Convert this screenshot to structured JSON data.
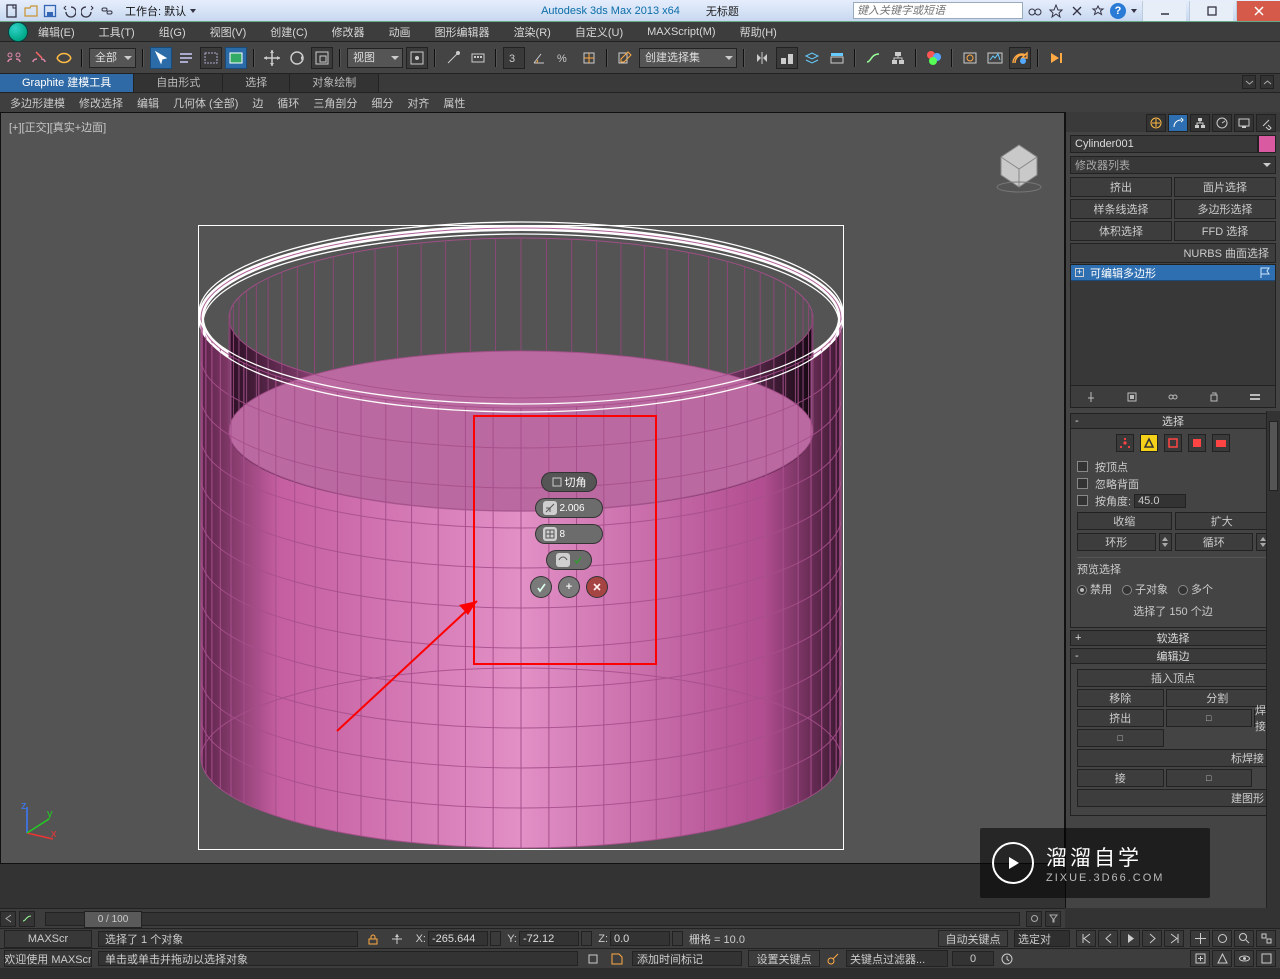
{
  "win": {
    "workspace_label": "工作台: 默认",
    "title_app": "Autodesk 3ds Max  2013 x64",
    "title_doc": "无标题",
    "search_ph": "键入关键字或短语"
  },
  "menu": [
    "编辑(E)",
    "工具(T)",
    "组(G)",
    "视图(V)",
    "创建(C)",
    "修改器",
    "动画",
    "图形编辑器",
    "渲染(R)",
    "自定义(U)",
    "MAXScript(M)",
    "帮助(H)"
  ],
  "toolbar": {
    "filter": "全部",
    "view": "视图",
    "named_sel": "创建选择集"
  },
  "ribbon": {
    "tabs": [
      "Graphite 建模工具",
      "自由形式",
      "选择",
      "对象绘制"
    ],
    "sub": [
      "多边形建模",
      "修改选择",
      "编辑",
      "几何体 (全部)",
      "边",
      "循环",
      "三角剖分",
      "细分",
      "对齐",
      "属性"
    ]
  },
  "viewport": {
    "corner": "[+][正交][真实+边面]"
  },
  "caddy": {
    "title": "切角",
    "amount": "2.006",
    "segments": "8"
  },
  "cmd": {
    "object": "Cylinder001",
    "modlist_ph": "修改器列表",
    "btns": [
      "挤出",
      "面片选择",
      "样条线选择",
      "多边形选择",
      "体积选择",
      "FFD 选择"
    ],
    "btn_wide": "NURBS 曲面选择",
    "stack_item": "可编辑多边形",
    "roll_sel": "选择",
    "sel_byvertex": "按顶点",
    "sel_backface": "忽略背面",
    "sel_byangle": "按角度:",
    "sel_angle": "45.0",
    "sel_shrink": "收缩",
    "sel_grow": "扩大",
    "sel_ring": "环形",
    "sel_loop": "循环",
    "sel_preview": "预览选择",
    "sel_pv": [
      "禁用",
      "子对象",
      "多个"
    ],
    "sel_info": "选择了 150 个边",
    "roll_soft": "软选择",
    "roll_edit": "编辑边",
    "edit_insert": "插入顶点",
    "edit_remove": "移除",
    "edit_split": "分割",
    "edit_extrude": "挤出",
    "edit_weld": "焊接",
    "edit_targetweld": "标焊接",
    "edit_connect": "接",
    "edit_bridge": "接",
    "edit_shape": "建图形"
  },
  "status": {
    "maxscript": "MAXScr",
    "selcount": "选择了 1 个对象",
    "x": "-265.644",
    "y": "-72.12",
    "z": "0.0",
    "grid": "栅格 = 10.0",
    "autokey": "自动关键点",
    "selset": "选定对",
    "welcome": "欢迎使用  MAXScr",
    "hint": "单击或单击并拖动以选择对象",
    "addtime": "添加时间标记",
    "setkey": "设置关键点",
    "keyfilter": "关键点过滤器...",
    "frame": "0"
  },
  "track": {
    "label": "0 / 100"
  },
  "watermark": {
    "t1": "溜溜自学",
    "t2": "ZIXUE.3D66.COM"
  }
}
